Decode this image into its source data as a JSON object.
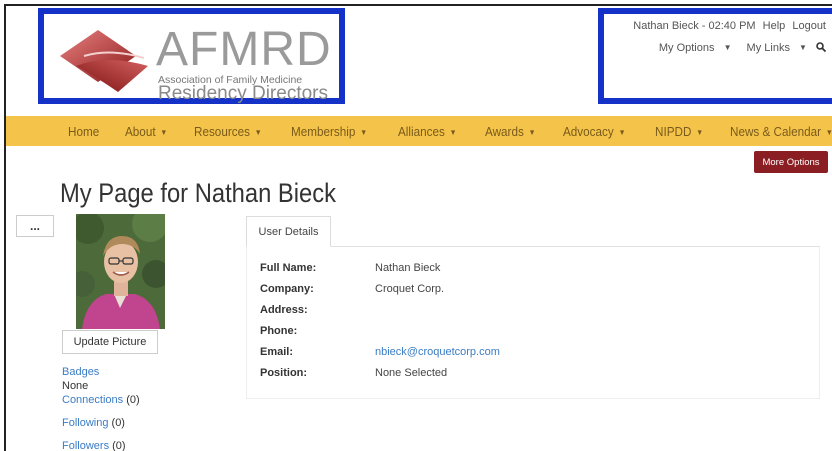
{
  "logo": {
    "big": "AFMRD",
    "small": "Association of Family Medicine",
    "mid": "Residency Directors"
  },
  "user_bar": {
    "user_time": "Nathan Bieck - 02:40 PM",
    "help": "Help",
    "logout": "Logout",
    "my_options": "My Options",
    "my_links": "My Links"
  },
  "nav": {
    "items": [
      "Home",
      "About",
      "Resources",
      "Membership",
      "Alliances",
      "Awards",
      "Advocacy",
      "NIPDD",
      "News & Calendar"
    ]
  },
  "more_options": "More Options",
  "page_title": "My Page for Nathan Bieck",
  "dots": "...",
  "update_picture": "Update Picture",
  "side": {
    "badges": "Badges",
    "badges_value": "None",
    "connections": "Connections",
    "connections_count": "(0)",
    "following": "Following",
    "following_count": "(0)",
    "followers": "Followers",
    "followers_count": "(0)"
  },
  "tab_label": "User Details",
  "fields": [
    {
      "label": "Full Name:",
      "value": "Nathan Bieck"
    },
    {
      "label": "Company:",
      "value": "Croquet Corp."
    },
    {
      "label": "Address:",
      "value": ""
    },
    {
      "label": "Phone:",
      "value": ""
    },
    {
      "label": "Email:",
      "value": "nbieck@croquetcorp.com"
    },
    {
      "label": "Position:",
      "value": "None Selected"
    }
  ],
  "colors": {
    "nav_bg": "#f4c44a",
    "highlight_border": "#1432c8",
    "more_btn": "#8b1e22",
    "link": "#3a7cc4"
  }
}
